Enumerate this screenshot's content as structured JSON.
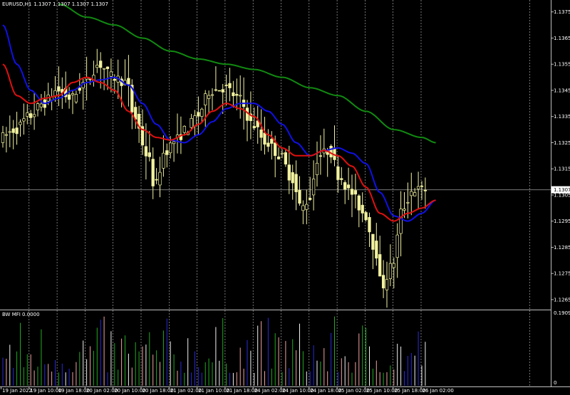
{
  "header": {
    "symbol": "EURUSD,H1",
    "ohlc": "1.1307 1.1307 1.1307 1.1307"
  },
  "indicator": {
    "label": "BW MFI 0.0000",
    "scale_top": "0.1909",
    "scale_bottom": "0"
  },
  "price_axis": [
    "1.1375",
    "1.1365",
    "1.1355",
    "1.1345",
    "1.1335",
    "1.1325",
    "1.1315",
    "1.1305",
    "1.1295",
    "1.1285",
    "1.1275",
    "1.1265"
  ],
  "current_price": "1.1307",
  "time_axis": [
    "19 Jan 2022",
    "19 Jan 10:00",
    "19 Jan 18:00",
    "20 Jan 02:00",
    "20 Jan 10:00",
    "20 Jan 18:00",
    "21 Jan 02:00",
    "21 Jan 10:00",
    "21 Jan 18:00",
    "24 Jan 02:00",
    "24 Jan 10:00",
    "24 Jan 18:00",
    "25 Jan 02:00",
    "25 Jan 10:00",
    "25 Jan 18:00",
    "26 Jan 02:00"
  ],
  "colors": {
    "background": "#000000",
    "candle": "#f2f2a0",
    "ma_red": "#e01010",
    "ma_blue": "#1010e8",
    "ma_green": "#118a11",
    "grid": "#bfbfbf",
    "axis_text": "#ffffff",
    "mfi_colors": [
      "#f2a0a0",
      "#2a2ad8",
      "#22aa22",
      "#f2f2f2"
    ]
  },
  "chart_data": {
    "type": "line",
    "series": [],
    "ylim": [
      1.1262,
      1.1379
    ],
    "control_points": {
      "price": [
        [
          0,
          1.1327
        ],
        [
          4,
          1.133
        ],
        [
          8,
          1.1335
        ],
        [
          12,
          1.134
        ],
        [
          16,
          1.1345
        ],
        [
          20,
          1.1342
        ],
        [
          24,
          1.1348
        ],
        [
          28,
          1.1355
        ],
        [
          32,
          1.135
        ],
        [
          36,
          1.1348
        ],
        [
          38,
          1.1335
        ],
        [
          42,
          1.132
        ],
        [
          44,
          1.1308
        ],
        [
          47,
          1.1322
        ],
        [
          50,
          1.1326
        ],
        [
          53,
          1.133
        ],
        [
          56,
          1.1335
        ],
        [
          60,
          1.1345
        ],
        [
          64,
          1.1346
        ],
        [
          68,
          1.1342
        ],
        [
          72,
          1.1332
        ],
        [
          76,
          1.1325
        ],
        [
          80,
          1.132
        ],
        [
          83,
          1.1312
        ],
        [
          86,
          1.13
        ],
        [
          88,
          1.1303
        ],
        [
          91,
          1.132
        ],
        [
          94,
          1.1322
        ],
        [
          97,
          1.1312
        ],
        [
          100,
          1.1306
        ],
        [
          104,
          1.1298
        ],
        [
          107,
          1.1285
        ],
        [
          109,
          1.127
        ],
        [
          112,
          1.1278
        ],
        [
          115,
          1.13
        ],
        [
          118,
          1.1307
        ],
        [
          121,
          1.1307
        ]
      ],
      "red": [
        [
          0,
          1.1355
        ],
        [
          4,
          1.1343
        ],
        [
          8,
          1.134
        ],
        [
          12,
          1.1342
        ],
        [
          16,
          1.1343
        ],
        [
          20,
          1.1348
        ],
        [
          24,
          1.135
        ],
        [
          28,
          1.1348
        ],
        [
          32,
          1.1345
        ],
        [
          36,
          1.1337
        ],
        [
          40,
          1.133
        ],
        [
          44,
          1.1327
        ],
        [
          48,
          1.1326
        ],
        [
          52,
          1.1328
        ],
        [
          56,
          1.1332
        ],
        [
          60,
          1.1337
        ],
        [
          64,
          1.134
        ],
        [
          68,
          1.1338
        ],
        [
          72,
          1.1335
        ],
        [
          76,
          1.1328
        ],
        [
          80,
          1.1323
        ],
        [
          84,
          1.132
        ],
        [
          88,
          1.132
        ],
        [
          92,
          1.1322
        ],
        [
          96,
          1.132
        ],
        [
          100,
          1.1316
        ],
        [
          104,
          1.1308
        ],
        [
          108,
          1.1298
        ],
        [
          112,
          1.1295
        ],
        [
          116,
          1.1298
        ],
        [
          120,
          1.13
        ],
        [
          124,
          1.1303
        ]
      ],
      "blue": [
        [
          0,
          1.137
        ],
        [
          4,
          1.1355
        ],
        [
          8,
          1.1345
        ],
        [
          12,
          1.134
        ],
        [
          16,
          1.1342
        ],
        [
          20,
          1.1345
        ],
        [
          24,
          1.1348
        ],
        [
          28,
          1.1349
        ],
        [
          32,
          1.135
        ],
        [
          36,
          1.1347
        ],
        [
          40,
          1.134
        ],
        [
          44,
          1.1332
        ],
        [
          48,
          1.1326
        ],
        [
          52,
          1.1325
        ],
        [
          56,
          1.1328
        ],
        [
          60,
          1.1333
        ],
        [
          64,
          1.1338
        ],
        [
          68,
          1.134
        ],
        [
          72,
          1.134
        ],
        [
          76,
          1.1337
        ],
        [
          80,
          1.1332
        ],
        [
          84,
          1.1325
        ],
        [
          88,
          1.132
        ],
        [
          92,
          1.1322
        ],
        [
          96,
          1.1323
        ],
        [
          100,
          1.1321
        ],
        [
          104,
          1.1317
        ],
        [
          108,
          1.1306
        ],
        [
          112,
          1.1297
        ],
        [
          116,
          1.1295
        ],
        [
          120,
          1.1298
        ],
        [
          124,
          1.1303
        ]
      ],
      "green": [
        [
          16,
          1.1378
        ],
        [
          24,
          1.1373
        ],
        [
          32,
          1.137
        ],
        [
          40,
          1.1365
        ],
        [
          48,
          1.136
        ],
        [
          56,
          1.1357
        ],
        [
          64,
          1.1355
        ],
        [
          72,
          1.1353
        ],
        [
          80,
          1.135
        ],
        [
          88,
          1.1346
        ],
        [
          96,
          1.1343
        ],
        [
          104,
          1.1337
        ],
        [
          112,
          1.133
        ],
        [
          120,
          1.1327
        ],
        [
          124,
          1.1325
        ]
      ]
    }
  }
}
